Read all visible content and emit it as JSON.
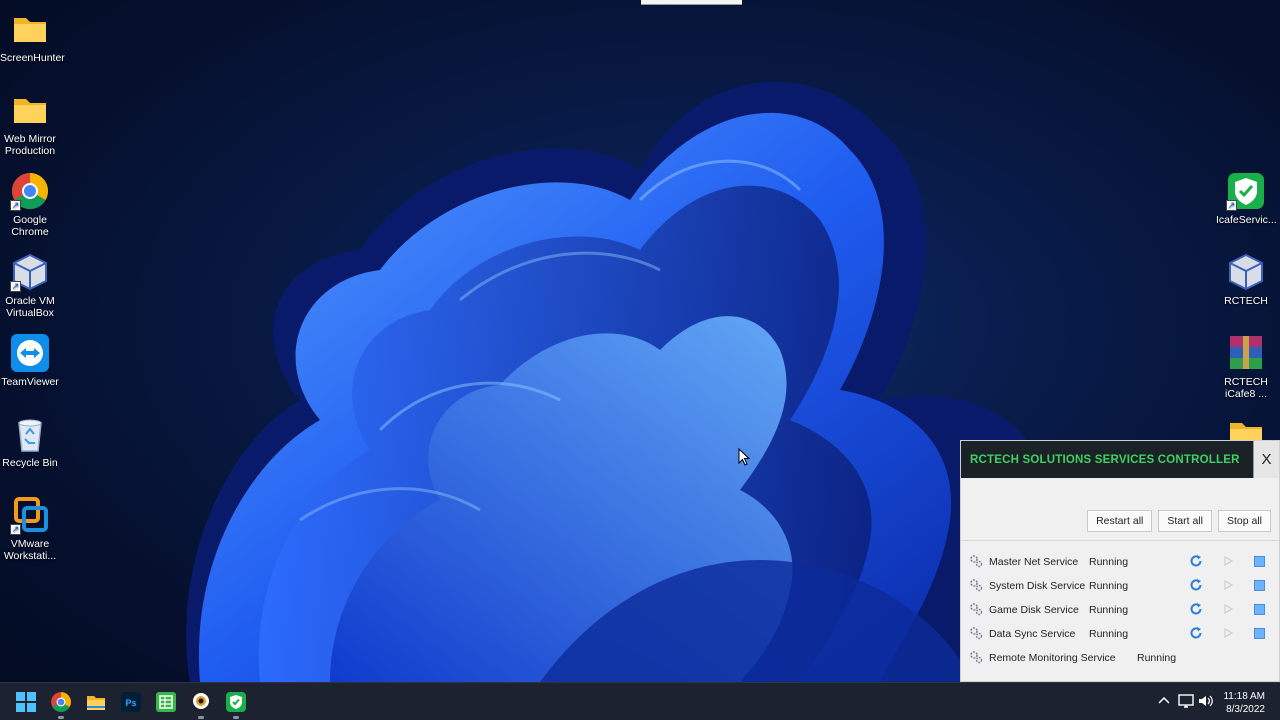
{
  "desktop": {
    "left_icons": [
      {
        "label": "ScreenHunter",
        "icon": "folder-icon"
      },
      {
        "label": "Web Mirror Production",
        "icon": "folder-icon"
      },
      {
        "label": "Google Chrome",
        "icon": "chrome-icon"
      },
      {
        "label": "Oracle VM VirtualBox",
        "icon": "virtualbox-icon"
      },
      {
        "label": "TeamViewer",
        "icon": "teamviewer-icon"
      },
      {
        "label": "Recycle Bin",
        "icon": "recycle-bin-icon"
      },
      {
        "label": "VMware Workstati...",
        "icon": "vmware-icon"
      }
    ],
    "right_icons": [
      {
        "label": "IcafeServic...",
        "icon": "icafe-service-icon"
      },
      {
        "label": "RCTECH",
        "icon": "virtualbox-icon"
      },
      {
        "label": "RCTECH iCafe8 ...",
        "icon": "winrar-icon"
      },
      {
        "label": "",
        "icon": "folder-icon"
      }
    ]
  },
  "controller": {
    "title": "RCTECH SOLUTIONS SERVICES CONTROLLER",
    "close_label": "X",
    "buttons": {
      "restart_all": "Restart all",
      "start_all": "Start all",
      "stop_all": "Stop all"
    },
    "services": [
      {
        "name": "Master Net Service",
        "status": "Running"
      },
      {
        "name": "System Disk Service",
        "status": "Running"
      },
      {
        "name": "Game Disk Service",
        "status": "Running"
      },
      {
        "name": "Data Sync Service",
        "status": "Running"
      },
      {
        "name": "Remote Monitoring Service",
        "status": "Running"
      }
    ],
    "colors": {
      "title": "#3fd160",
      "titlebar": "#1a2127",
      "stop": "#6fb2ff",
      "restart": "#2f7fd8"
    }
  },
  "taskbar": {
    "apps": [
      "start-icon",
      "chrome-icon",
      "file-explorer-icon",
      "photoshop-icon",
      "spreadsheet-icon",
      "webcam-icon",
      "icafe-shield-icon"
    ],
    "photoshop_label": "Ps",
    "clock": {
      "time": "11:18 AM",
      "date": "8/3/2022"
    }
  }
}
